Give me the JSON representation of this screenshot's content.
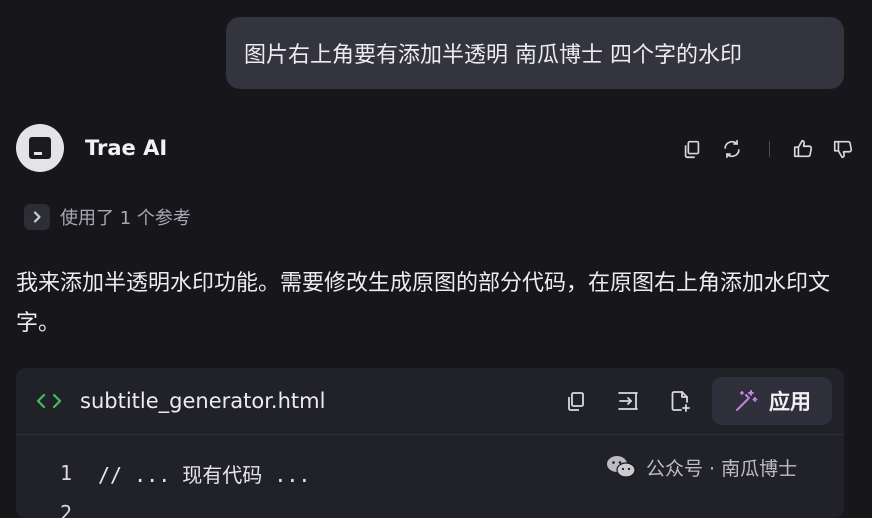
{
  "user_message": "图片右上角要有添加半透明 南瓜博士 四个字的水印",
  "assistant": {
    "name": "Trae AI",
    "avatar_icon": "trae-logo-icon",
    "actions": [
      "copy-icon",
      "refresh-icon",
      "thumbs-up-icon",
      "thumbs-down-icon"
    ],
    "reference_text": "使用了 1 个参考",
    "message": "我来添加半透明水印功能。需要修改生成原图的部分代码，在原图右上角添加水印文字。"
  },
  "code_block": {
    "filename": "subtitle_generator.html",
    "apply_label": "应用",
    "lines": [
      {
        "number": "1",
        "text": "// ... 现有代码 ..."
      },
      {
        "number": "2",
        "text": ""
      }
    ]
  },
  "watermark": {
    "text": "公众号 · 南瓜博士"
  },
  "colors": {
    "background": "#17171b",
    "bubble": "#33343e",
    "code_card": "#212228",
    "code_icon_green": "#3fbf5a",
    "apply_gradient_start": "#f08ac2",
    "apply_gradient_end": "#8d7cf6"
  }
}
